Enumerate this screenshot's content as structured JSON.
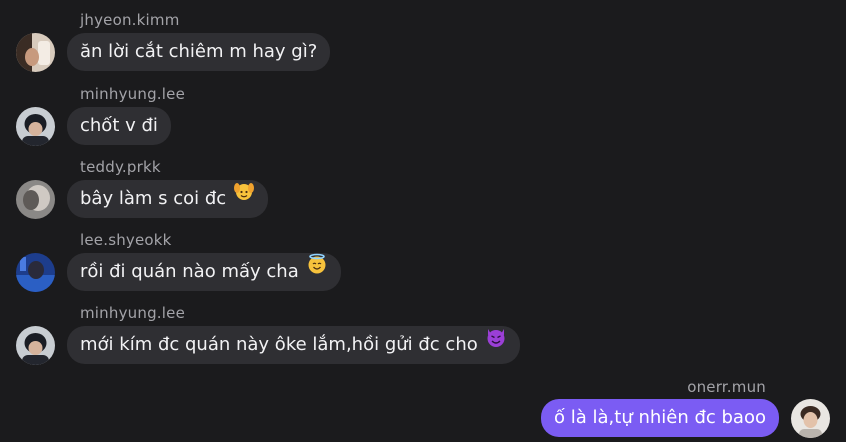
{
  "messages": [
    {
      "username": "jhyeon.kimm",
      "text": "ăn lời cắt chiêm m hay gì?",
      "emoji": null,
      "avatar_icon": "avatar-photo-hand-icon",
      "mine": false
    },
    {
      "username": "minhyung.lee",
      "text": "chốt v đi",
      "emoji": null,
      "avatar_icon": "avatar-photo-cap-icon",
      "mine": false
    },
    {
      "username": "teddy.prkk",
      "text": "bây làm s coi đc",
      "emoji": "face-with-raised-hands-icon",
      "avatar_icon": "avatar-photo-gray-icon",
      "mine": false
    },
    {
      "username": "lee.shyeokk",
      "text": "rồi đi quán nào mấy cha",
      "emoji": "smiling-face-with-halo-icon",
      "avatar_icon": "avatar-photo-blue-icon",
      "mine": false
    },
    {
      "username": "minhyung.lee",
      "text": "mới kím đc quán này ôke lắm,hồi gửi đc cho",
      "emoji": "smiling-devil-icon",
      "avatar_icon": "avatar-photo-cap-icon",
      "mine": false
    },
    {
      "username": "onerr.mun",
      "text": "ố là là,tự nhiên đc baoo",
      "emoji": null,
      "avatar_icon": "avatar-photo-light-icon",
      "mine": true
    }
  ],
  "colors": {
    "background": "#1b1b1d",
    "bubble_incoming": "#2f2f33",
    "bubble_outgoing": "#7b5cf3",
    "username": "#a3a3a8",
    "text": "#f2f2f4"
  }
}
